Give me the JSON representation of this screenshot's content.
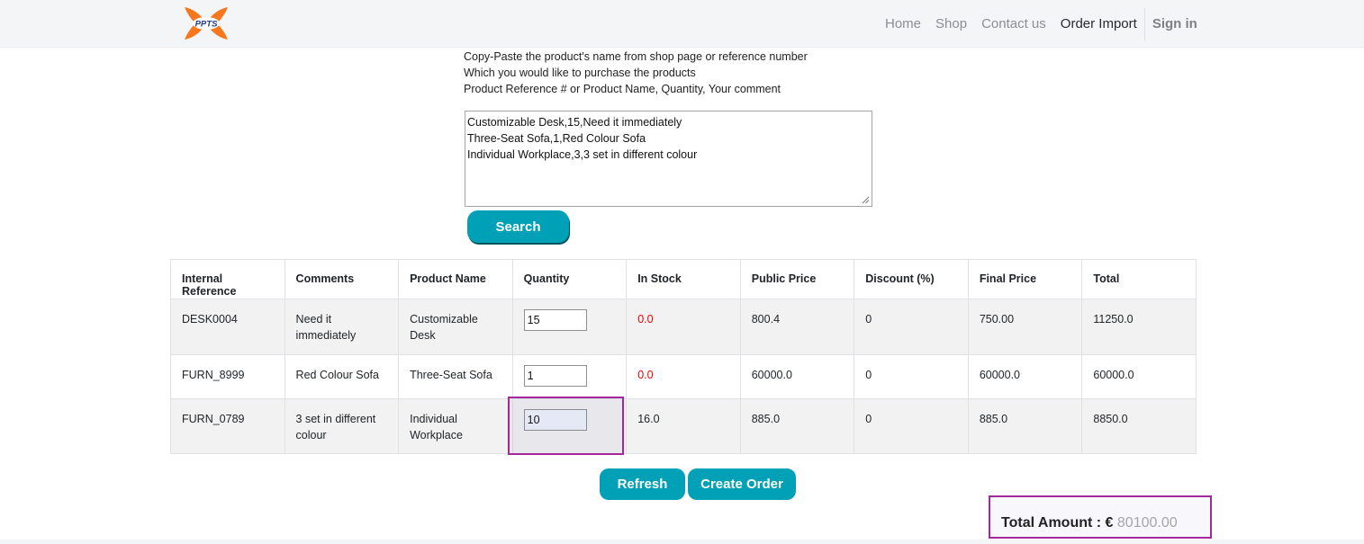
{
  "brand": {
    "logo_text": "PPTS",
    "primary_color": "#f7771c",
    "accent_color": "#00a0b6"
  },
  "nav": {
    "items": [
      {
        "label": "Home"
      },
      {
        "label": "Shop"
      },
      {
        "label": "Contact us"
      },
      {
        "label": "Order Import"
      }
    ],
    "active": "Order Import",
    "signin_label": "Sign in"
  },
  "instructions": {
    "line1": "Copy-Paste the product's name from shop page or reference number",
    "line2": "Which you would like to purchase the products",
    "line3": "Product Reference # or Product Name, Quantity, Your comment"
  },
  "order_input": {
    "value": "Customizable Desk,15,Need it immediately\nThree-Seat Sofa,1,Red Colour Sofa\nIndividual Workplace,3,3 set in different colour"
  },
  "search_label": "Search",
  "table": {
    "headers": [
      "Internal Reference",
      "Comments",
      "Product Name",
      "Quantity",
      "In Stock",
      "Public Price",
      "Discount (%)",
      "Final Price",
      "Total"
    ],
    "rows": [
      {
        "ref": "DESK0004",
        "comment": "Need it immediately",
        "product": "Customizable Desk",
        "quantity": "15",
        "stock": "0.0",
        "stock_status": "out",
        "public_price": "800.4",
        "discount": "0",
        "final_price": "750.00",
        "total": "11250.0"
      },
      {
        "ref": "FURN_8999",
        "comment": "Red Colour Sofa",
        "product": "Three-Seat Sofa",
        "quantity": "1",
        "stock": "0.0",
        "stock_status": "out",
        "public_price": "60000.0",
        "discount": "0",
        "final_price": "60000.0",
        "total": "60000.0"
      },
      {
        "ref": "FURN_0789",
        "comment": "3 set in different colour",
        "product": "Individual Workplace",
        "quantity": "10",
        "stock": "16.0",
        "stock_status": "in",
        "public_price": "885.0",
        "discount": "0",
        "final_price": "885.0",
        "total": "8850.0"
      }
    ]
  },
  "actions": {
    "refresh_label": "Refresh",
    "create_order_label": "Create Order"
  },
  "total": {
    "label": "Total Amount : €",
    "value": "80100.00"
  }
}
